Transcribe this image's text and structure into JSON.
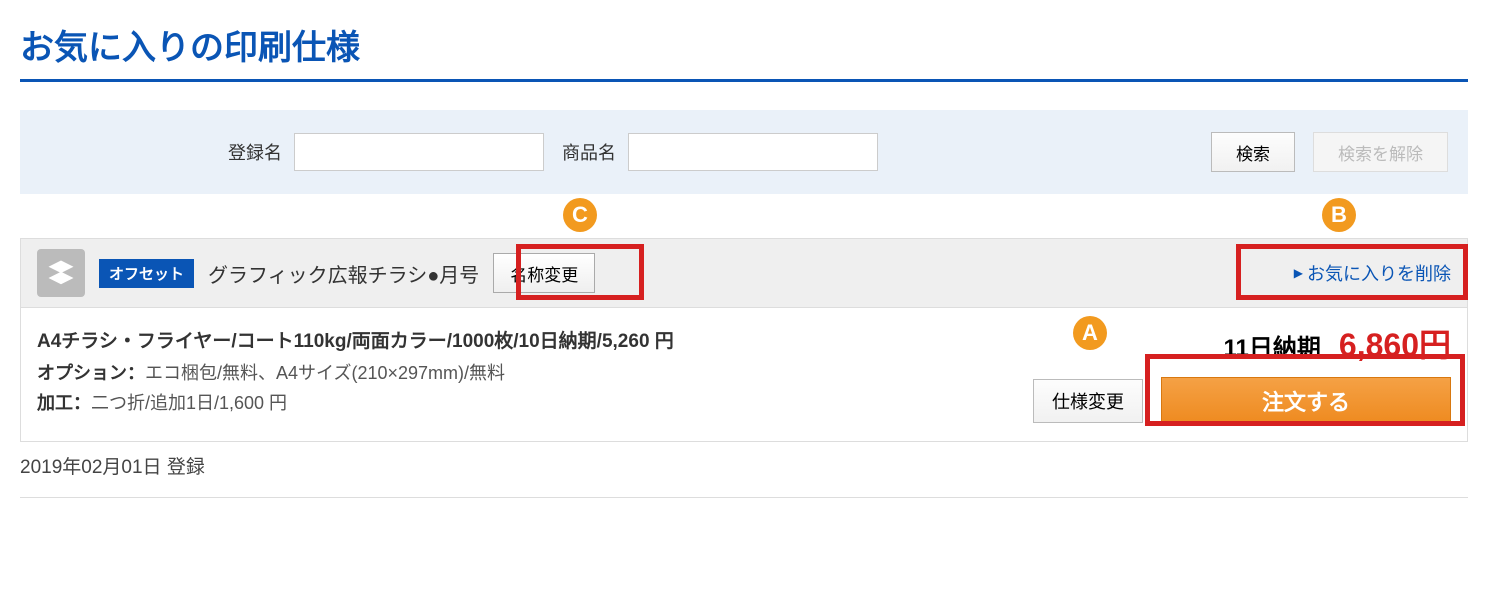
{
  "page_title": "お気に入りの印刷仕様",
  "search": {
    "name_label": "登録名",
    "product_label": "商品名",
    "search_btn": "検索",
    "clear_btn": "検索を解除",
    "name_value": "",
    "product_value": ""
  },
  "item": {
    "badge": "オフセット",
    "name": "グラフィック広報チラシ●月号",
    "rename_btn": "名称変更",
    "delete_link": "お気に入りを削除",
    "spec_line": "A4チラシ・フライヤー/コート110kg/両面カラー/1000枚/10日納期/5,260 円",
    "option_label": "オプション：",
    "option_value": "エコ梱包/無料、A4サイズ(210×297mm)/無料",
    "processing_label": "加工：",
    "processing_value": "二つ折/追加1日/1,600 円",
    "delivery": "11日納期",
    "price": "6,860円",
    "spec_change_btn": "仕様変更",
    "order_btn": "注文する"
  },
  "registered": "2019年02月01日 登録",
  "callouts": {
    "a": "A",
    "b": "B",
    "c": "C"
  }
}
